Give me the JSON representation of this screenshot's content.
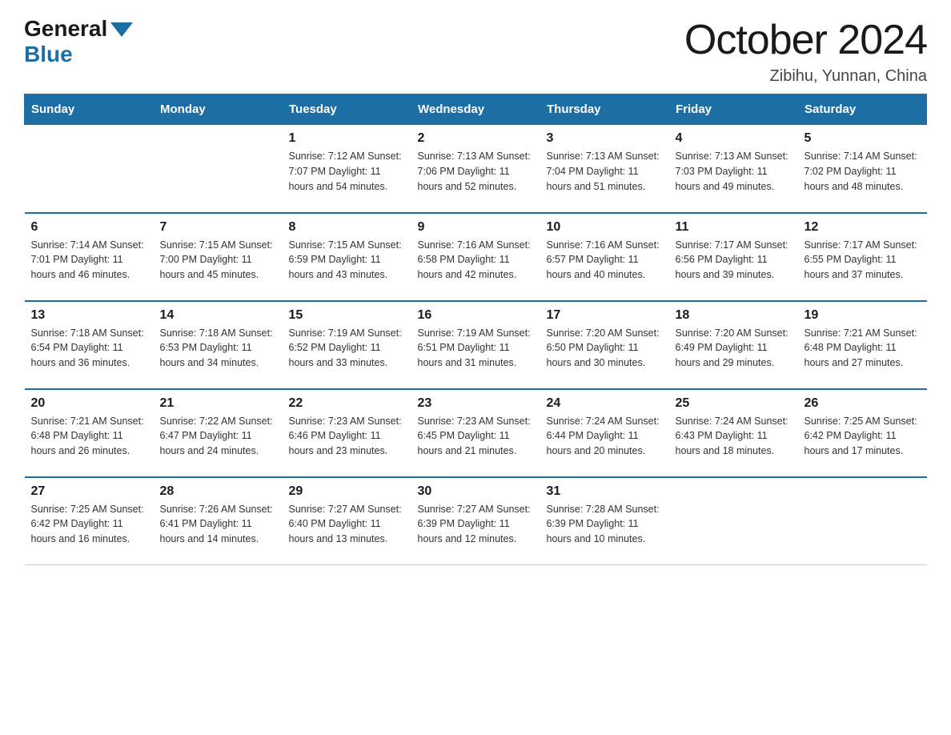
{
  "logo": {
    "general": "General",
    "blue": "Blue"
  },
  "title": "October 2024",
  "location": "Zibihu, Yunnan, China",
  "days_of_week": [
    "Sunday",
    "Monday",
    "Tuesday",
    "Wednesday",
    "Thursday",
    "Friday",
    "Saturday"
  ],
  "weeks": [
    [
      {
        "day": "",
        "info": ""
      },
      {
        "day": "",
        "info": ""
      },
      {
        "day": "1",
        "info": "Sunrise: 7:12 AM\nSunset: 7:07 PM\nDaylight: 11 hours\nand 54 minutes."
      },
      {
        "day": "2",
        "info": "Sunrise: 7:13 AM\nSunset: 7:06 PM\nDaylight: 11 hours\nand 52 minutes."
      },
      {
        "day": "3",
        "info": "Sunrise: 7:13 AM\nSunset: 7:04 PM\nDaylight: 11 hours\nand 51 minutes."
      },
      {
        "day": "4",
        "info": "Sunrise: 7:13 AM\nSunset: 7:03 PM\nDaylight: 11 hours\nand 49 minutes."
      },
      {
        "day": "5",
        "info": "Sunrise: 7:14 AM\nSunset: 7:02 PM\nDaylight: 11 hours\nand 48 minutes."
      }
    ],
    [
      {
        "day": "6",
        "info": "Sunrise: 7:14 AM\nSunset: 7:01 PM\nDaylight: 11 hours\nand 46 minutes."
      },
      {
        "day": "7",
        "info": "Sunrise: 7:15 AM\nSunset: 7:00 PM\nDaylight: 11 hours\nand 45 minutes."
      },
      {
        "day": "8",
        "info": "Sunrise: 7:15 AM\nSunset: 6:59 PM\nDaylight: 11 hours\nand 43 minutes."
      },
      {
        "day": "9",
        "info": "Sunrise: 7:16 AM\nSunset: 6:58 PM\nDaylight: 11 hours\nand 42 minutes."
      },
      {
        "day": "10",
        "info": "Sunrise: 7:16 AM\nSunset: 6:57 PM\nDaylight: 11 hours\nand 40 minutes."
      },
      {
        "day": "11",
        "info": "Sunrise: 7:17 AM\nSunset: 6:56 PM\nDaylight: 11 hours\nand 39 minutes."
      },
      {
        "day": "12",
        "info": "Sunrise: 7:17 AM\nSunset: 6:55 PM\nDaylight: 11 hours\nand 37 minutes."
      }
    ],
    [
      {
        "day": "13",
        "info": "Sunrise: 7:18 AM\nSunset: 6:54 PM\nDaylight: 11 hours\nand 36 minutes."
      },
      {
        "day": "14",
        "info": "Sunrise: 7:18 AM\nSunset: 6:53 PM\nDaylight: 11 hours\nand 34 minutes."
      },
      {
        "day": "15",
        "info": "Sunrise: 7:19 AM\nSunset: 6:52 PM\nDaylight: 11 hours\nand 33 minutes."
      },
      {
        "day": "16",
        "info": "Sunrise: 7:19 AM\nSunset: 6:51 PM\nDaylight: 11 hours\nand 31 minutes."
      },
      {
        "day": "17",
        "info": "Sunrise: 7:20 AM\nSunset: 6:50 PM\nDaylight: 11 hours\nand 30 minutes."
      },
      {
        "day": "18",
        "info": "Sunrise: 7:20 AM\nSunset: 6:49 PM\nDaylight: 11 hours\nand 29 minutes."
      },
      {
        "day": "19",
        "info": "Sunrise: 7:21 AM\nSunset: 6:48 PM\nDaylight: 11 hours\nand 27 minutes."
      }
    ],
    [
      {
        "day": "20",
        "info": "Sunrise: 7:21 AM\nSunset: 6:48 PM\nDaylight: 11 hours\nand 26 minutes."
      },
      {
        "day": "21",
        "info": "Sunrise: 7:22 AM\nSunset: 6:47 PM\nDaylight: 11 hours\nand 24 minutes."
      },
      {
        "day": "22",
        "info": "Sunrise: 7:23 AM\nSunset: 6:46 PM\nDaylight: 11 hours\nand 23 minutes."
      },
      {
        "day": "23",
        "info": "Sunrise: 7:23 AM\nSunset: 6:45 PM\nDaylight: 11 hours\nand 21 minutes."
      },
      {
        "day": "24",
        "info": "Sunrise: 7:24 AM\nSunset: 6:44 PM\nDaylight: 11 hours\nand 20 minutes."
      },
      {
        "day": "25",
        "info": "Sunrise: 7:24 AM\nSunset: 6:43 PM\nDaylight: 11 hours\nand 18 minutes."
      },
      {
        "day": "26",
        "info": "Sunrise: 7:25 AM\nSunset: 6:42 PM\nDaylight: 11 hours\nand 17 minutes."
      }
    ],
    [
      {
        "day": "27",
        "info": "Sunrise: 7:25 AM\nSunset: 6:42 PM\nDaylight: 11 hours\nand 16 minutes."
      },
      {
        "day": "28",
        "info": "Sunrise: 7:26 AM\nSunset: 6:41 PM\nDaylight: 11 hours\nand 14 minutes."
      },
      {
        "day": "29",
        "info": "Sunrise: 7:27 AM\nSunset: 6:40 PM\nDaylight: 11 hours\nand 13 minutes."
      },
      {
        "day": "30",
        "info": "Sunrise: 7:27 AM\nSunset: 6:39 PM\nDaylight: 11 hours\nand 12 minutes."
      },
      {
        "day": "31",
        "info": "Sunrise: 7:28 AM\nSunset: 6:39 PM\nDaylight: 11 hours\nand 10 minutes."
      },
      {
        "day": "",
        "info": ""
      },
      {
        "day": "",
        "info": ""
      }
    ]
  ],
  "colors": {
    "header_bg": "#1c6ea4",
    "header_text": "#ffffff",
    "border": "#1c6ea4",
    "text": "#333333"
  }
}
